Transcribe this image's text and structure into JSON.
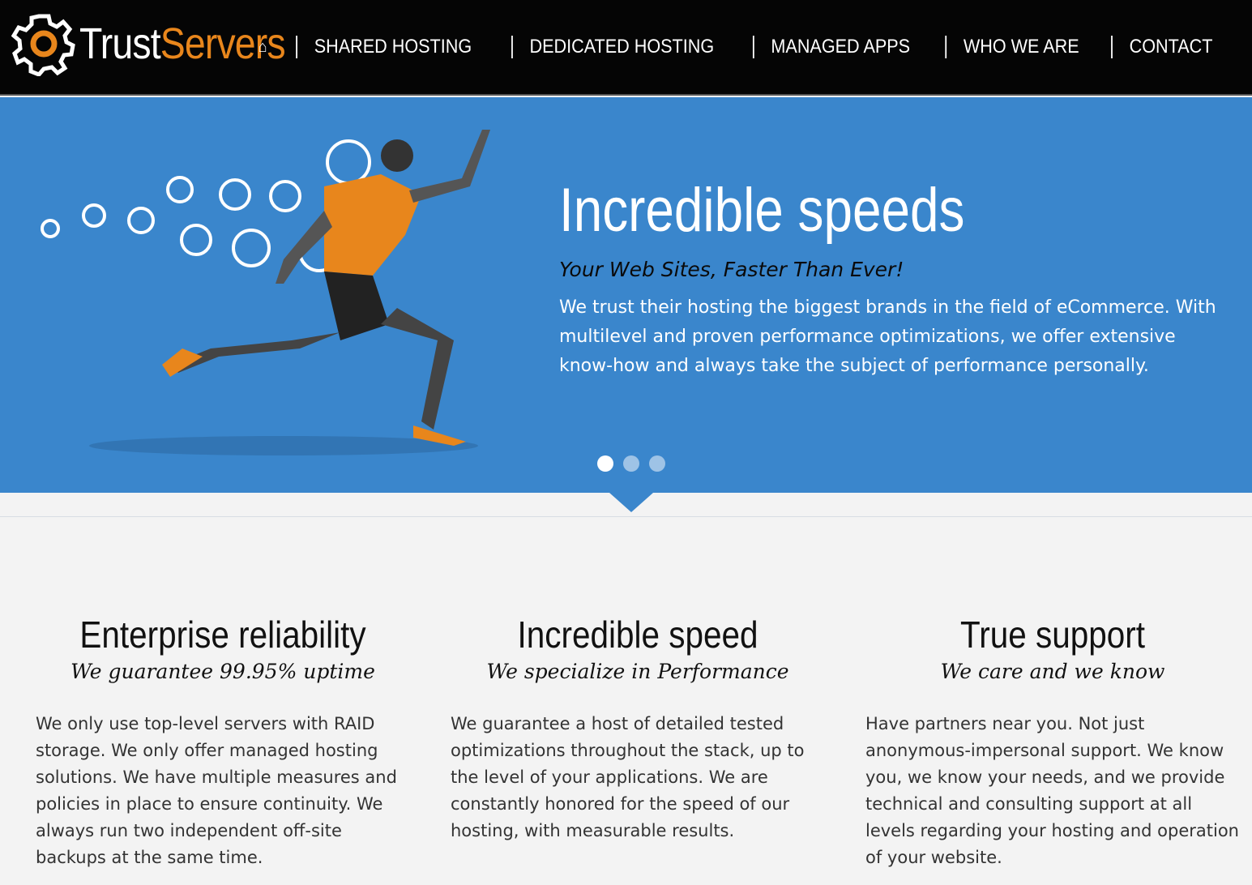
{
  "header": {
    "logo": {
      "part1": "Trust",
      "part2": "Servers"
    },
    "nav": [
      {
        "icon": "home-icon"
      },
      {
        "label": "SHARED HOSTING"
      },
      {
        "label": "DEDICATED HOSTING"
      },
      {
        "label": "MANAGED APPS"
      },
      {
        "label": "WHO WE ARE"
      },
      {
        "label": "CONTACT"
      }
    ]
  },
  "hero": {
    "title": "Incredible speeds",
    "subtitle": "Your Web Sites, Faster Than Ever!",
    "text": "We trust their hosting the biggest brands in the field of eCommerce. With multilevel and proven performance optimizations, we offer extensive know-how and always take the subject of performance personally.",
    "slides": 3,
    "active_slide": 1,
    "colors": {
      "background": "#3a86cc",
      "accent": "#e8861c"
    }
  },
  "features": [
    {
      "title": "Enterprise reliability",
      "subtitle": "We guarantee 99.95% uptime",
      "text": "We only use top-level servers with RAID storage. We only offer managed hosting solutions. We have multiple measures and policies in place to ensure continuity. We always run two independent off-site backups at the same time."
    },
    {
      "title": "Incredible speed",
      "subtitle": "We specialize in Performance",
      "text": "We guarantee a host of detailed tested optimizations throughout the stack, up to the level of your applications. We are constantly honored for the speed of our hosting, with measurable results."
    },
    {
      "title": "True support",
      "subtitle": "We care and we know",
      "text": "Have partners near you. Not just anonymous-impersonal support. We know you, we know your needs, and we provide technical and consulting support at all levels regarding your hosting and operation of your website."
    }
  ]
}
